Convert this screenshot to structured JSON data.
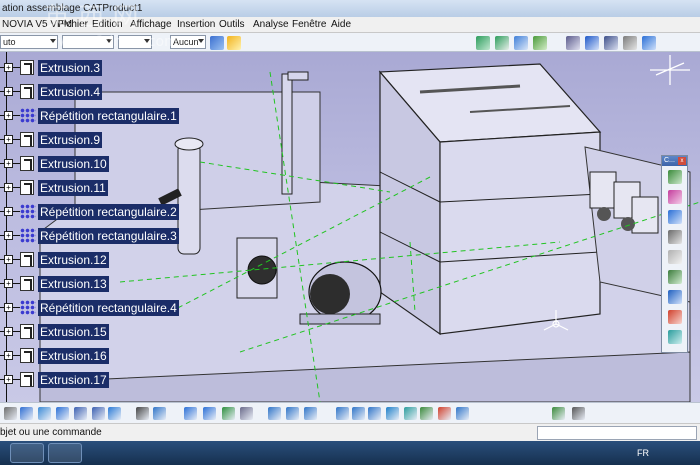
{
  "window": {
    "title": "ation assemblage CATProduct1"
  },
  "menubar": {
    "product": "NOVIA V5 VPM",
    "items": [
      "Fichier",
      "Edition",
      "Affichage",
      "Insertion",
      "Outils",
      "Analyse",
      "Fenêtre",
      "Aide"
    ]
  },
  "toolbar": {
    "combo_left": "uto",
    "combo_right": "Aucun"
  },
  "tree": {
    "items": [
      {
        "label": "Extrusion.3",
        "kind": "extrusion"
      },
      {
        "label": "Extrusion.4",
        "kind": "extrusion"
      },
      {
        "label": "Répétition rectangulaire.1",
        "kind": "pattern"
      },
      {
        "label": "Extrusion.9",
        "kind": "extrusion"
      },
      {
        "label": "Extrusion.10",
        "kind": "extrusion"
      },
      {
        "label": "Extrusion.11",
        "kind": "extrusion"
      },
      {
        "label": "Répétition rectangulaire.2",
        "kind": "pattern"
      },
      {
        "label": "Répétition rectangulaire.3",
        "kind": "pattern"
      },
      {
        "label": "Extrusion.12",
        "kind": "extrusion"
      },
      {
        "label": "Extrusion.13",
        "kind": "extrusion"
      },
      {
        "label": "Répétition rectangulaire.4",
        "kind": "pattern"
      },
      {
        "label": "Extrusion.15",
        "kind": "extrusion"
      },
      {
        "label": "Extrusion.16",
        "kind": "extrusion"
      },
      {
        "label": "Extrusion.17",
        "kind": "extrusion"
      }
    ]
  },
  "palette": {
    "title": "C..."
  },
  "statusbar": {
    "text": "bjet ou une commande",
    "command_value": ""
  },
  "taskbar": {
    "language": "FR"
  },
  "watermark": {
    "text": "3dmox.com"
  },
  "colors": {
    "tree_highlight": "#1b2d68",
    "viewport_top": "#a9a9d4",
    "viewport_bottom": "#c9c9e6",
    "model_face": "#d8d8ec",
    "axis_green": "#22c422"
  }
}
